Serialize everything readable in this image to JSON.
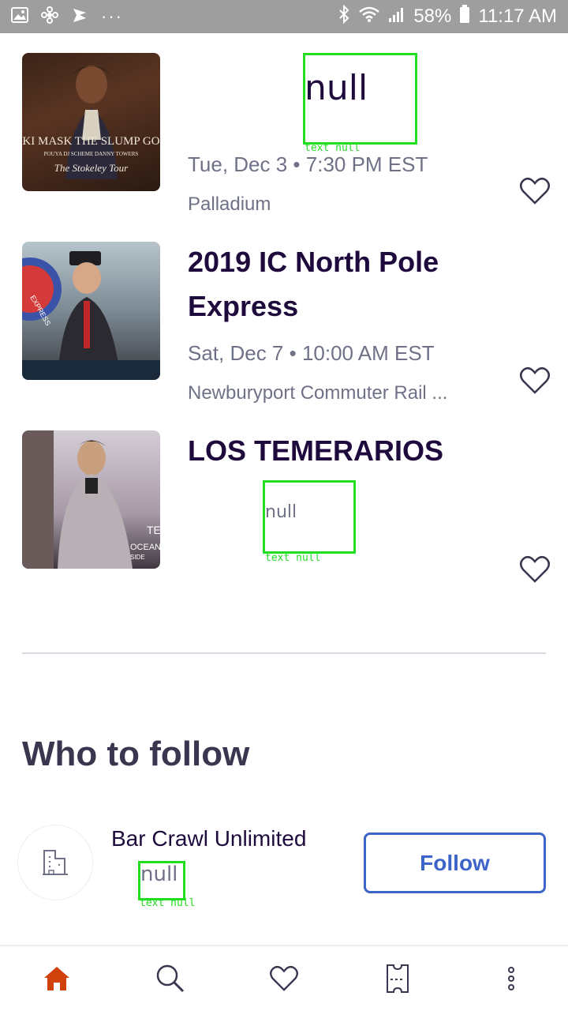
{
  "status_bar": {
    "battery": "58%",
    "time": "11:17 AM",
    "overflow": "···",
    "icons": [
      "gallery-icon",
      "pinwheel-icon",
      "cast-icon",
      "bluetooth-icon",
      "wifi-icon",
      "signal-icon",
      "battery-icon"
    ]
  },
  "events": [
    {
      "title": "null",
      "date": "Tue, Dec 3 • 7:30 PM EST",
      "venue": "Palladium",
      "image_caption_line1": "KI MASK THE SLUMP GO",
      "image_caption_line2": "POUYA     DJ SCHEME     DANNY TOWERS",
      "image_caption_line3": "The Stokeley Tour",
      "overlay_caption": "text null"
    },
    {
      "title": "2019 IC North Pole Express",
      "date": "Sat, Dec 7 • 10:00 AM EST",
      "venue": "Newburyport Commuter Rail ...",
      "image_caption_line1": "EXPRESS"
    },
    {
      "title": "LOS TEMERARIOS",
      "date": "null",
      "venue": "",
      "image_caption_line1": "OCEAN",
      "image_caption_line2": "SIDE",
      "image_caption_line3": "TE",
      "overlay_caption": "text null"
    }
  ],
  "who_to_follow": {
    "title": "Who to follow",
    "organizer": {
      "name": "Bar Crawl Unlimited",
      "subtitle": "null",
      "overlay_caption": "text null",
      "follow_label": "Follow"
    }
  },
  "nav": {
    "items": [
      "home-icon",
      "search-icon",
      "heart-icon",
      "ticket-icon",
      "more-icon"
    ],
    "active": "home-icon",
    "active_color": "#d1410c"
  }
}
